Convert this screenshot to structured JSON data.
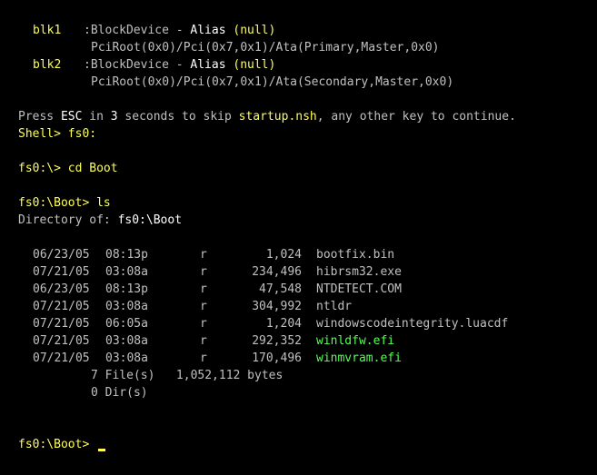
{
  "colors": {
    "background": "#000000",
    "default_text": "#c0c0c0",
    "highlight_yellow": "#ffff55",
    "bright_white": "#ffffff",
    "executable_green": "#55ff55"
  },
  "block_devices": [
    {
      "name": "blk1",
      "type": ":BlockDevice - ",
      "alias_label": "Alias",
      "alias_value": "(null)",
      "path": "PciRoot(0x0)/Pci(0x7,0x1)/Ata(Primary,Master,0x0)"
    },
    {
      "name": "blk2",
      "type": ":BlockDevice - ",
      "alias_label": "Alias",
      "alias_value": "(null)",
      "path": "PciRoot(0x0)/Pci(0x7,0x1)/Ata(Secondary,Master,0x0)"
    }
  ],
  "startup": {
    "press": "Press ",
    "esc": "ESC",
    "in": " in ",
    "seconds": "3",
    "skip": " seconds to skip ",
    "script": "startup.nsh",
    "rest": ", any other key to continue."
  },
  "shell_line": "Shell> fs0:",
  "cd_prompt": "fs0:\\> ",
  "cd_command": "cd Boot",
  "ls_prompt": "fs0:\\Boot> ",
  "ls_command": "ls",
  "directory_label": "Directory of: ",
  "directory_path": "fs0:\\Boot",
  "files": [
    {
      "date": "06/23/05",
      "time": "08:13p",
      "attr": "r",
      "size": "1,024",
      "name": "bootfix.bin",
      "efi": false
    },
    {
      "date": "07/21/05",
      "time": "03:08a",
      "attr": "r",
      "size": "234,496",
      "name": "hibrsm32.exe",
      "efi": false
    },
    {
      "date": "06/23/05",
      "time": "08:13p",
      "attr": "r",
      "size": "47,548",
      "name": "NTDETECT.COM",
      "efi": false
    },
    {
      "date": "07/21/05",
      "time": "03:08a",
      "attr": "r",
      "size": "304,992",
      "name": "ntldr",
      "efi": false
    },
    {
      "date": "07/21/05",
      "time": "06:05a",
      "attr": "r",
      "size": "1,204",
      "name": "windowscodeintegrity.luacdf",
      "efi": false
    },
    {
      "date": "07/21/05",
      "time": "03:08a",
      "attr": "r",
      "size": "292,352",
      "name": "winldfw.efi",
      "efi": true
    },
    {
      "date": "07/21/05",
      "time": "03:08a",
      "attr": "r",
      "size": "170,496",
      "name": "winmvram.efi",
      "efi": true
    }
  ],
  "summary": {
    "files_line": "7 File(s)   1,052,112 bytes",
    "dirs_line": "0 Dir(s)"
  },
  "final_prompt": "fs0:\\Boot> "
}
